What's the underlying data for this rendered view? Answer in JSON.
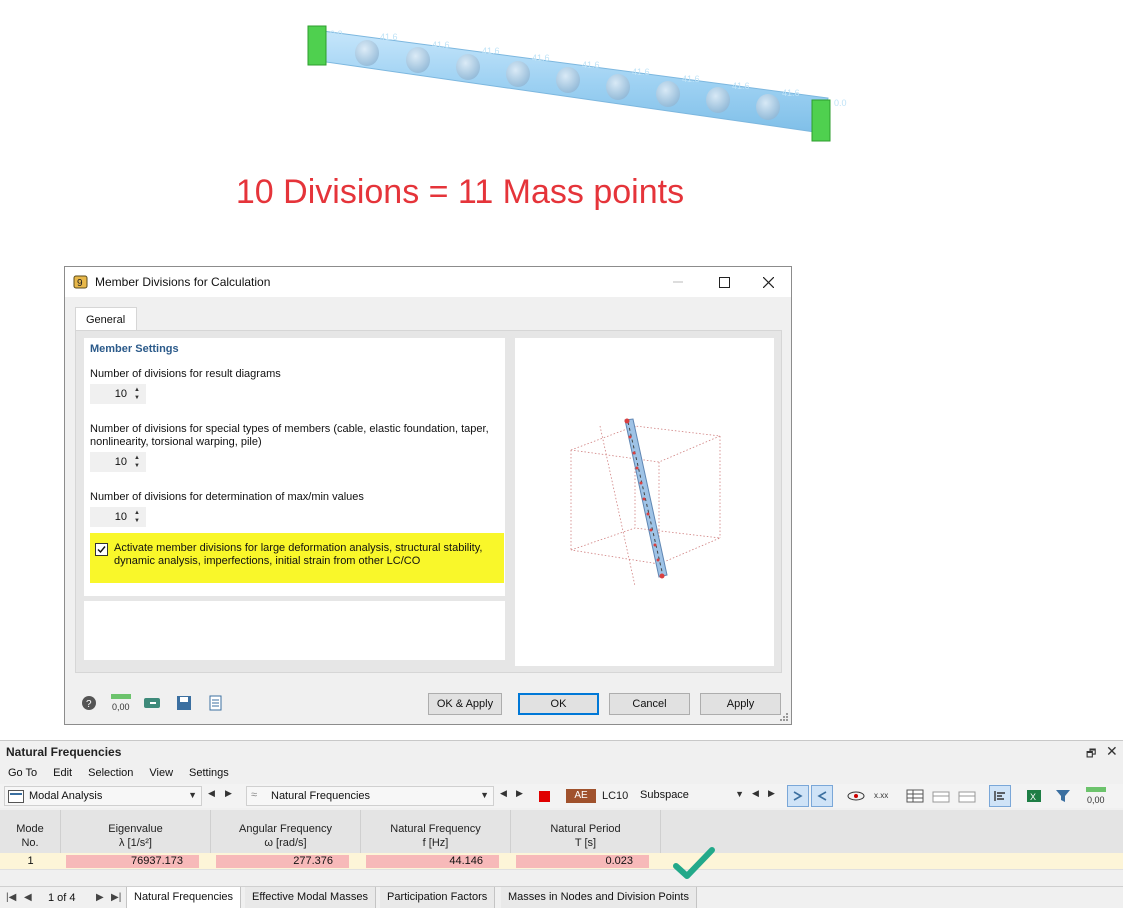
{
  "headline": "10 Divisions = 11 Mass points",
  "beam": {
    "end_labels": [
      "0.0",
      "0.0"
    ],
    "point_labels": [
      "41.6",
      "41.6",
      "41.6",
      "41.6",
      "41.6",
      "41.6",
      "41.6",
      "41.6",
      "41.6",
      "41.6"
    ]
  },
  "dialog": {
    "title": "Member Divisions for Calculation",
    "tab": "General",
    "section_title": "Member Settings",
    "fields": [
      {
        "label": "Number of divisions for result diagrams",
        "value": "10"
      },
      {
        "label": "Number of divisions for special types of members (cable, elastic foundation, taper, nonlinearity, torsional warping, pile)",
        "value": "10"
      },
      {
        "label": "Number of divisions for determination of max/min values",
        "value": "10"
      }
    ],
    "activate_checkbox": {
      "checked": true,
      "label": "Activate member divisions for large deformation analysis, structural stability, dynamic analysis, imperfections, initial strain from other LC/CO"
    },
    "footer_icons": [
      "help-icon",
      "units-icon",
      "calculator-icon",
      "save-icon",
      "library-icon"
    ],
    "buttons": {
      "ok_apply": "OK & Apply",
      "ok": "OK",
      "cancel": "Cancel",
      "apply": "Apply"
    }
  },
  "panel": {
    "title": "Natural Frequencies",
    "menu": [
      "Go To",
      "Edit",
      "Selection",
      "View",
      "Settings"
    ],
    "analysis_combo": "Modal Analysis",
    "result_combo": "Natural Frequencies",
    "load_case_badge": "AE",
    "load_case": "LC10",
    "solver_combo": "Subspace",
    "columns": [
      {
        "line1": "Mode",
        "line2": "No."
      },
      {
        "line1": "Eigenvalue",
        "line2": "λ [1/s²]"
      },
      {
        "line1": "Angular Frequency",
        "line2": "ω [rad/s]"
      },
      {
        "line1": "Natural Frequency",
        "line2": "f [Hz]"
      },
      {
        "line1": "Natural Period",
        "line2": "T [s]"
      }
    ],
    "rows": [
      {
        "mode": "1",
        "eigenvalue": "76937.173",
        "angular": "277.376",
        "frequency": "44.146",
        "period": "0.023"
      }
    ],
    "page_info": "1 of 4",
    "tabs": [
      "Natural Frequencies",
      "Effective Modal Masses",
      "Participation Factors",
      "Masses in Nodes and Division Points"
    ],
    "colors": {
      "accent": "#0078d7",
      "badge": "#a0522d",
      "highlight": "#f9f72a",
      "headline": "#e5343a",
      "value_cell": "#f7b9b9",
      "row": "#fdf5d8"
    }
  }
}
